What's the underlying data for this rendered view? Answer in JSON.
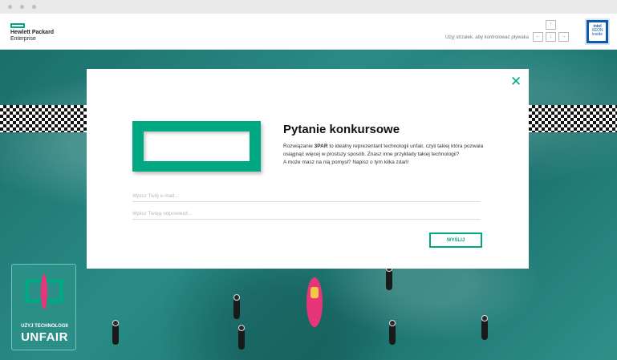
{
  "header": {
    "logo_line1": "Hewlett Packard",
    "logo_line2": "Enterprise",
    "hint": "Użyj strzałek, aby kontrolować pływaka",
    "arrows": {
      "up": "↑",
      "left": "←",
      "down": "↓",
      "right": "→"
    },
    "badge": {
      "brand": "intel",
      "line2": "XEON",
      "line3": "inside"
    }
  },
  "modal": {
    "title": "Pytanie konkursowe",
    "desc_prefix": "Rozwiązanie ",
    "desc_bold": "3PAR",
    "desc_rest": " to idealny reprezentant technologii unfair, czyli takiej która pozwala osiągnąć więcej w prostszy sposób. Znasz inne przykłady takiej technologii?",
    "desc_line2": "A może masz na nią pomysł? Napisz o tym kilka zdań!",
    "email_placeholder": "Wpisz Twój e-mail...",
    "answer_placeholder": "Wpisz Twoją odpowiedź...",
    "send_label": "WYŚLIJ",
    "close_label": "✕"
  },
  "promo": {
    "small": "UŻYJ TECHNOLOGII",
    "big": "UNFAIR"
  },
  "colors": {
    "accent": "#01a982",
    "kayak": "#e8357a",
    "sea": "#1f7a76"
  }
}
